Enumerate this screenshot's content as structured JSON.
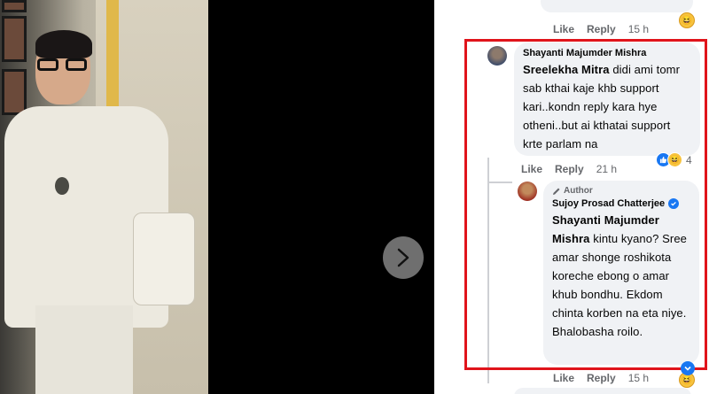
{
  "comments": [
    {
      "author": "Shayanti Majumder Mishra",
      "mention": "Sreelekha Mitra",
      "text": " didi ami tomr sab kthai kaje khb support kari..kondn reply kara hye otheni..but ai kthatai support krte parlam na",
      "actions": {
        "like": "Like",
        "reply": "Reply",
        "time": "21 h"
      },
      "reaction_count": "4"
    },
    {
      "author_tag": "Author",
      "author": "Sujoy Prosad Chatterjee",
      "mention": "Shayanti Majumder Mishra",
      "text": " kintu kyano? Sree amar shonge roshikota koreche ebong o amar khub bondhu. Ekdom chinta korben na eta niye. Bhalobasha roilo.",
      "actions": {
        "like": "Like",
        "reply": "Reply",
        "time": "15 h"
      }
    }
  ],
  "previous_actions": {
    "like": "Like",
    "reply": "Reply",
    "time": "15 h"
  },
  "colors": {
    "highlight": "#e0141b",
    "verified": "#1877f2"
  },
  "icons": {
    "next": "chevron-right-icon",
    "verified": "verified-badge-icon",
    "author": "pencil-icon"
  }
}
